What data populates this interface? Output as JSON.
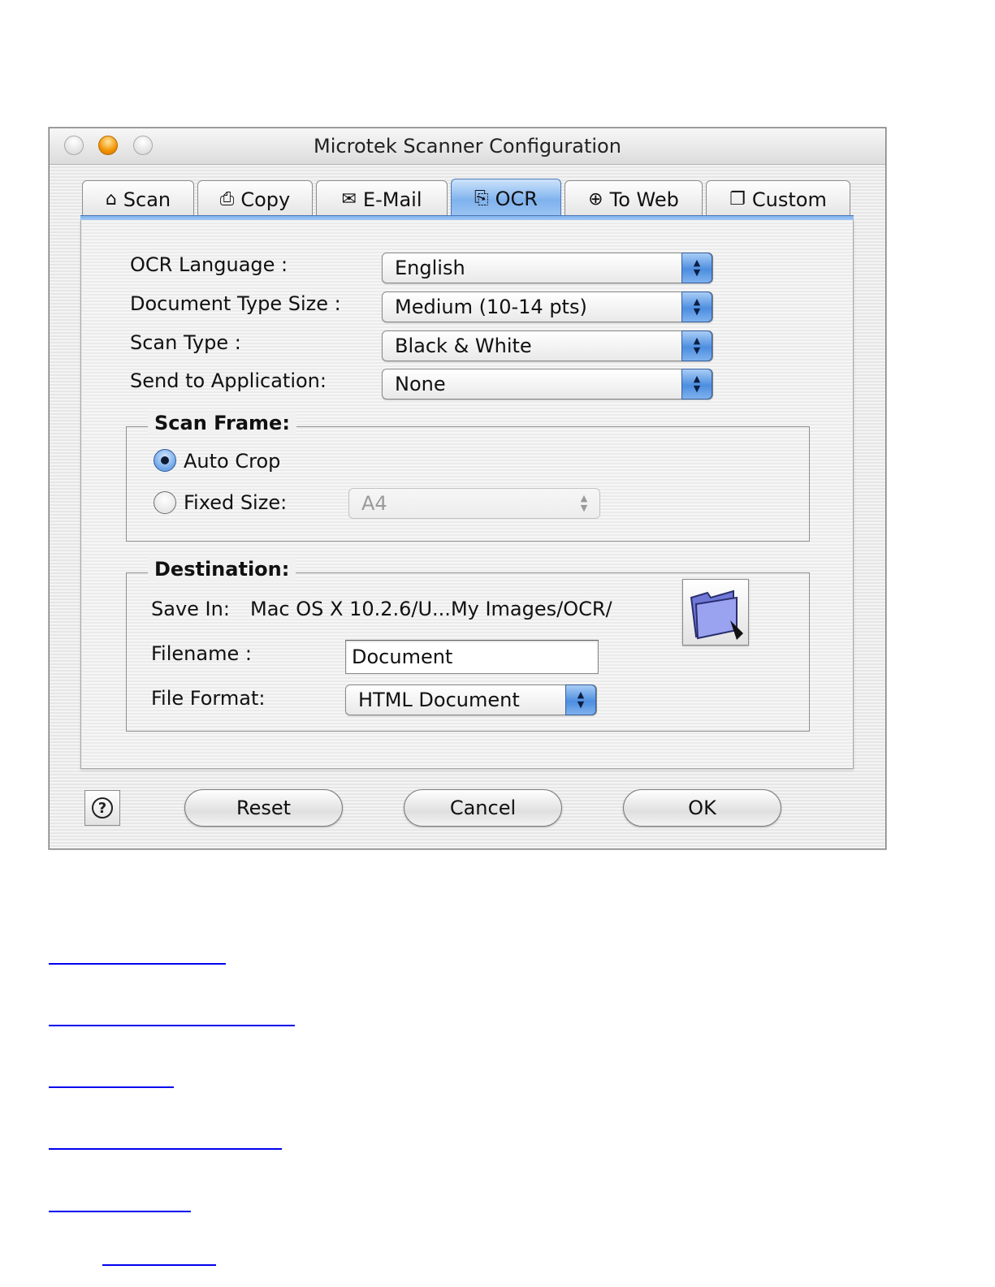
{
  "window": {
    "title": "Microtek Scanner Configuration"
  },
  "tabs": [
    {
      "label": "Scan",
      "icon": "scanner-icon",
      "glyph": "⌂"
    },
    {
      "label": "Copy",
      "icon": "printer-icon",
      "glyph": "⎙"
    },
    {
      "label": "E-Mail",
      "icon": "email-icon",
      "glyph": "✉"
    },
    {
      "label": "OCR",
      "icon": "ocr-icon",
      "glyph": "⎘"
    },
    {
      "label": "To Web",
      "icon": "globe-icon",
      "glyph": "⊕"
    },
    {
      "label": "Custom",
      "icon": "custom-icon",
      "glyph": "❐"
    }
  ],
  "selected_tab": "OCR",
  "settings": {
    "ocr_language_label": "OCR Language :",
    "ocr_language_value": "English",
    "doc_type_size_label": "Document Type Size :",
    "doc_type_size_value": "Medium (10-14 pts)",
    "scan_type_label": "Scan Type :",
    "scan_type_value": "Black & White",
    "send_to_app_label": "Send to Application:",
    "send_to_app_value": "None"
  },
  "scan_frame": {
    "title": "Scan Frame:",
    "auto_crop_label": "Auto Crop",
    "fixed_size_label": "Fixed Size:",
    "fixed_size_value": "A4",
    "selected": "Auto Crop"
  },
  "destination": {
    "title": "Destination:",
    "save_in_label": "Save In:",
    "save_in_path": "Mac OS X 10.2.6/U...My Images/OCR/",
    "filename_label": "Filename :",
    "filename_value": "Document",
    "file_format_label": "File Format:",
    "file_format_value": "HTML Document"
  },
  "buttons": {
    "help": "?",
    "reset": "Reset",
    "cancel": "Cancel",
    "ok": "OK"
  },
  "colors": {
    "accent_blue": "#7fb2ee",
    "traffic_orange": "#f29200",
    "link_blue": "#0000ee"
  }
}
